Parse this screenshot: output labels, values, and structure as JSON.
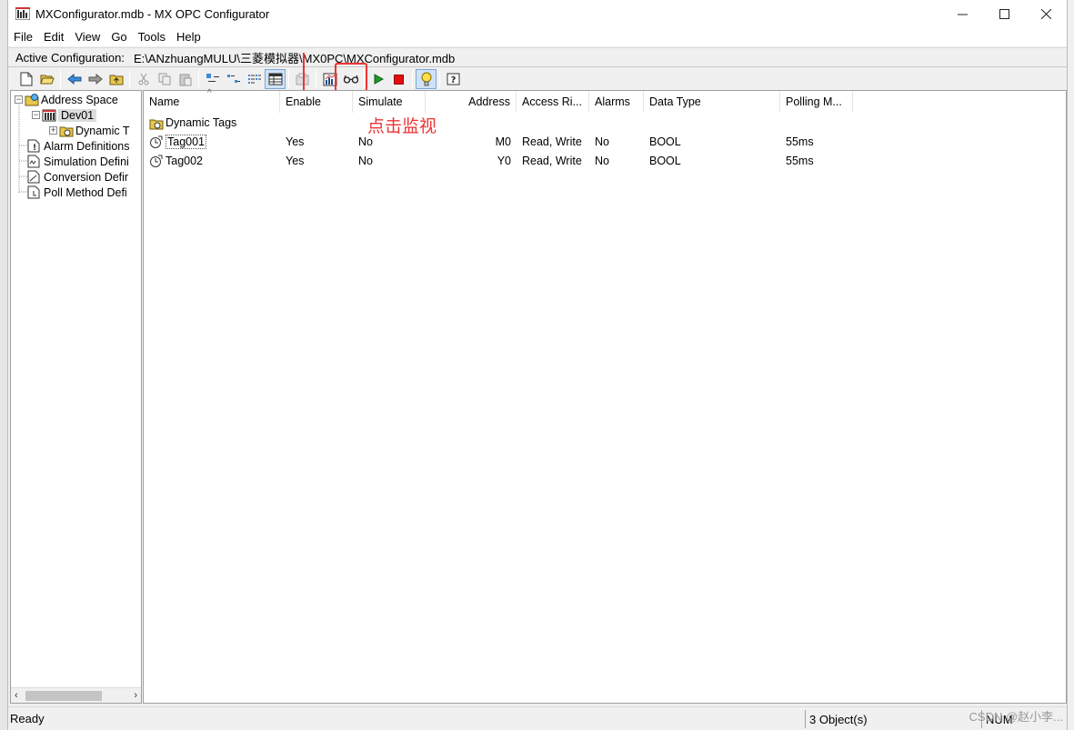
{
  "window": {
    "title": "MXConfigurator.mdb - MX OPC Configurator"
  },
  "menu": [
    {
      "label": "File",
      "key": "F"
    },
    {
      "label": "Edit",
      "key": "E"
    },
    {
      "label": "View",
      "key": "V"
    },
    {
      "label": "Go",
      "key": "G"
    },
    {
      "label": "Tools",
      "key": "T"
    },
    {
      "label": "Help",
      "key": "H"
    }
  ],
  "config": {
    "label": "Active Configuration:",
    "path": "E:\\ANzhuangMULU\\三菱模拟器\\MX0PC\\MXConfigurator.mdb"
  },
  "toolbar_icons": [
    "new-icon",
    "open-icon",
    "back-icon",
    "forward-icon",
    "up-folder-icon",
    "cut-icon",
    "copy-icon",
    "paste-icon",
    "large-icons-icon",
    "small-icons-icon",
    "list-icon",
    "details-icon",
    "properties-icon",
    "chart-icon",
    "monitor-glasses-icon",
    "run-icon",
    "stop-icon",
    "lightbulb-icon",
    "help-icon"
  ],
  "annotation": "点击监视",
  "tree": {
    "items": [
      {
        "label": "Address Space"
      },
      {
        "label": "Dev01"
      },
      {
        "label": "Dynamic T"
      },
      {
        "label": "Alarm Definitions"
      },
      {
        "label": "Simulation Defini"
      },
      {
        "label": "Conversion Defir"
      },
      {
        "label": "Poll Method Defi"
      }
    ]
  },
  "table": {
    "columns": [
      "Name",
      "Enable",
      "Simulate",
      "Address",
      "Access Ri...",
      "Alarms",
      "Data Type",
      "Polling M..."
    ],
    "folder_row": {
      "name": "Dynamic Tags"
    },
    "rows": [
      {
        "name": "Tag001",
        "enable": "Yes",
        "simulate": "No",
        "address": "M0",
        "access": "Read, Write",
        "alarms": "No",
        "data_type": "BOOL",
        "polling": "55ms"
      },
      {
        "name": "Tag002",
        "enable": "Yes",
        "simulate": "No",
        "address": "Y0",
        "access": "Read, Write",
        "alarms": "No",
        "data_type": "BOOL",
        "polling": "55ms"
      }
    ]
  },
  "status": {
    "text": "Ready",
    "objects": "3 Object(s)",
    "num": "NUM"
  },
  "watermark": "CSDN @赵小李..."
}
